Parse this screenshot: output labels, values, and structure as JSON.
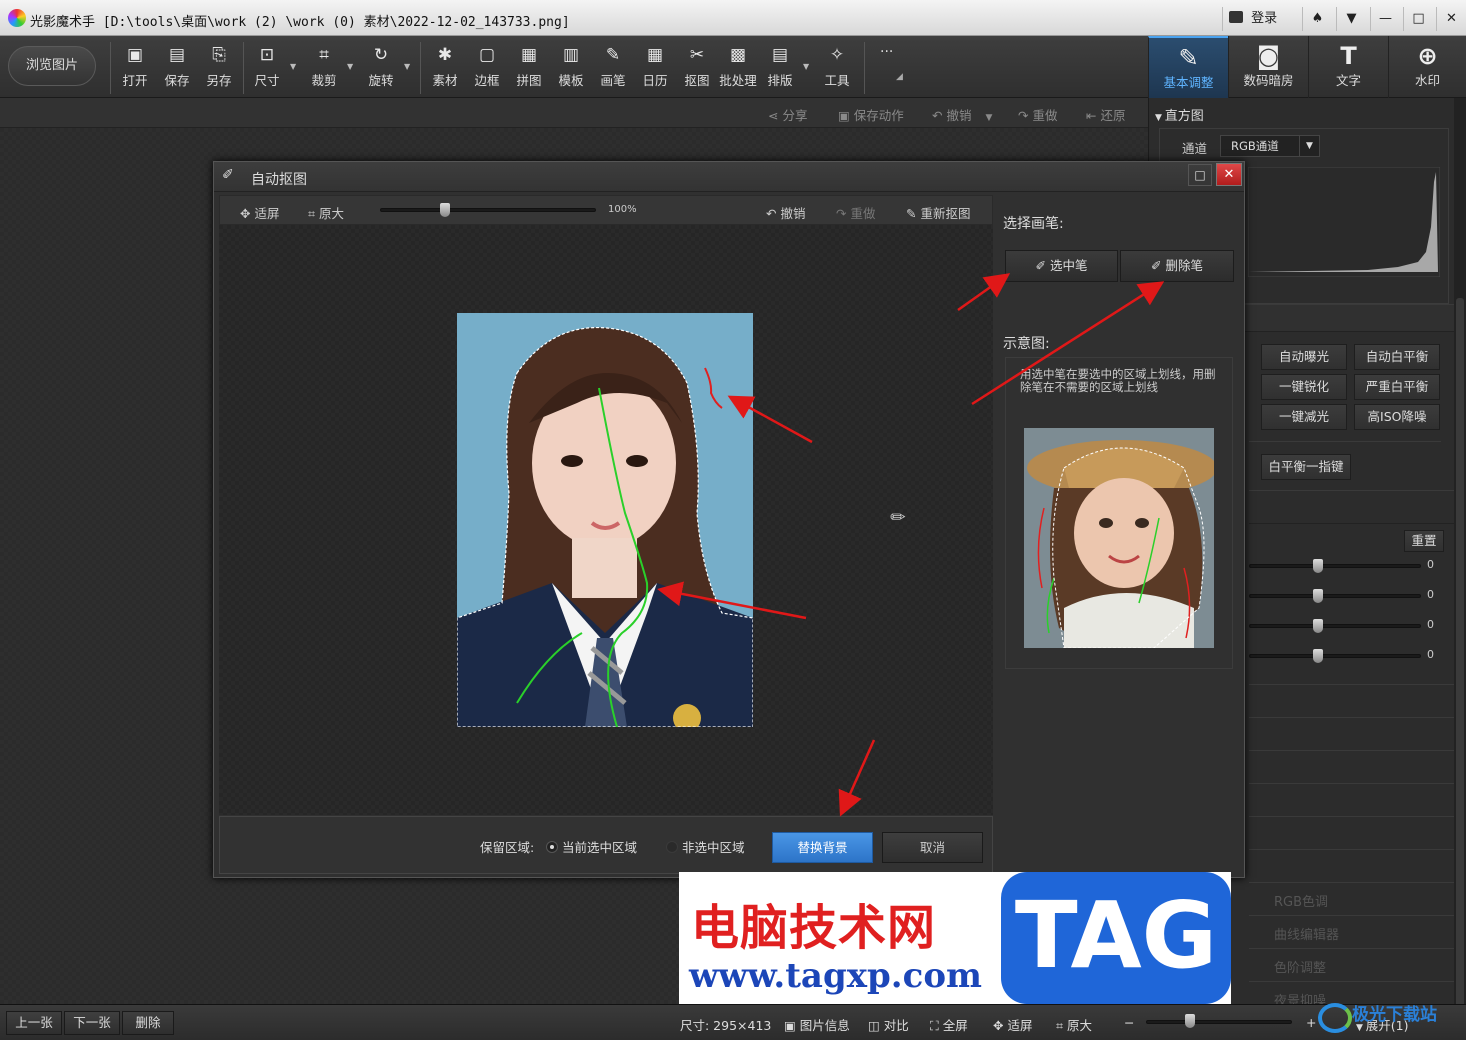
{
  "app": {
    "title": "光影魔术手  [D:\\tools\\桌面\\work (2) \\work (0) 素材\\2022-12-02_143733.png]",
    "login": "登录",
    "win_buttons": [
      "♠",
      "▼",
      "—",
      "□",
      "✕"
    ]
  },
  "toolbar": {
    "browse": "浏览图片",
    "items": [
      {
        "label": "打开",
        "icon": "▣"
      },
      {
        "label": "保存",
        "icon": "▤"
      },
      {
        "label": "另存",
        "icon": "⎘"
      },
      {
        "label": "尺寸",
        "icon": "⊡"
      },
      {
        "label": "裁剪",
        "icon": "⌗"
      },
      {
        "label": "旋转",
        "icon": "↻"
      },
      {
        "label": "素材",
        "icon": "✱"
      },
      {
        "label": "边框",
        "icon": "▢"
      },
      {
        "label": "拼图",
        "icon": "▦"
      },
      {
        "label": "模板",
        "icon": "▥"
      },
      {
        "label": "画笔",
        "icon": "✎"
      },
      {
        "label": "日历",
        "icon": "▦"
      },
      {
        "label": "抠图",
        "icon": "✂"
      },
      {
        "label": "批处理",
        "icon": "▩"
      },
      {
        "label": "排版",
        "icon": "▤"
      },
      {
        "label": "工具",
        "icon": "✧"
      }
    ],
    "more": "···",
    "tabs": [
      {
        "label": "基本调整",
        "icon": "✎"
      },
      {
        "label": "数码暗房",
        "icon": "◙"
      },
      {
        "label": "文字",
        "icon": "T"
      },
      {
        "label": "水印",
        "icon": "⊕"
      }
    ]
  },
  "subbar": {
    "share": "分享",
    "save_action": "保存动作",
    "undo": "撤销",
    "redo": "重做",
    "restore": "还原"
  },
  "right_panel": {
    "histogram": "直方图",
    "channel_label": "通道",
    "channel_value": "RGB通道",
    "buttons": [
      "自动曝光",
      "自动白平衡",
      "一键锐化",
      "严重白平衡",
      "一键减光",
      "高ISO降噪"
    ],
    "wb_button": "白平衡一指键",
    "reset": "重置",
    "slider_values": [
      "0",
      "0",
      "0",
      "0"
    ],
    "sliders": [
      0.4,
      0.4,
      0.4,
      0.4
    ],
    "ghost_items": [
      "RGB色调",
      "曲线编辑器",
      "色阶调整",
      "夜景抑噪"
    ]
  },
  "dialog": {
    "title": "自动抠图",
    "fit": "适屏",
    "actual": "原大",
    "zoom": "100%",
    "zoom_level": 0.3,
    "undo": "撤销",
    "redo": "重做",
    "rematte": "重新抠图",
    "select_brush": "选择画笔:",
    "pen_select": "选中笔",
    "pen_delete": "删除笔",
    "example_label": "示意图:",
    "hint": "用选中笔在要选中的区域上划线，用删除笔在不需要的区域上划线",
    "keep_area": "保留区域:",
    "opt_current": "当前选中区域",
    "opt_other": "非选中区域",
    "replace_bg": "替换背景",
    "cancel": "取消"
  },
  "status": {
    "prev": "上一张",
    "next": "下一张",
    "delete": "删除",
    "size": "尺寸: 295×413",
    "info": "图片信息",
    "compare": "对比",
    "fullscreen": "全屏",
    "fit": "适屏",
    "actual": "原大",
    "expand": "展开(1)",
    "zoom_level": 0.3
  },
  "watermark": {
    "text": "电脑技术网",
    "url": "www.tagxp.com",
    "tag": "TAG",
    "corner": "极光下载站"
  },
  "colors": {
    "accent": "#3c86d8",
    "select_stroke": "#2ad02a",
    "delete_stroke": "#e02020",
    "arrow": "#e01818"
  }
}
